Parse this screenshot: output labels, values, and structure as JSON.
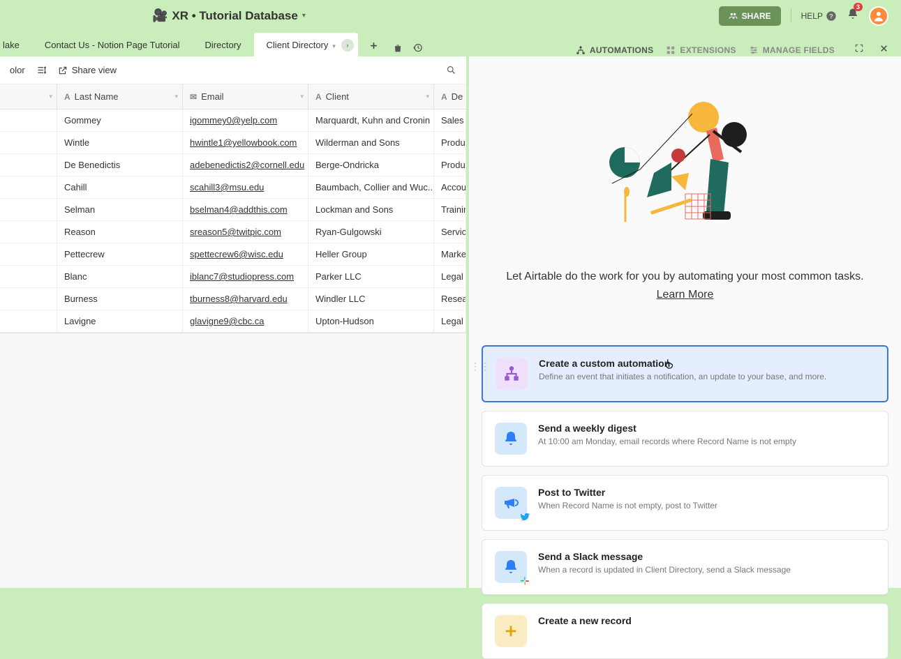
{
  "header": {
    "base_icon": "🎥",
    "title": "XR • Tutorial Database",
    "share_label": "SHARE",
    "help_label": "HELP",
    "notification_count": "3"
  },
  "tabs": {
    "items": [
      {
        "label": "lake",
        "partial": true
      },
      {
        "label": "Contact Us - Notion Page Tutorial"
      },
      {
        "label": "Directory"
      },
      {
        "label": "Client Directory",
        "active": true
      }
    ],
    "tools": {
      "automations": "AUTOMATIONS",
      "extensions": "EXTENSIONS",
      "manage_fields": "MANAGE FIELDS"
    }
  },
  "toolbar": {
    "color": "olor",
    "share_view": "Share view"
  },
  "grid": {
    "columns": [
      "",
      "Last Name",
      "Email",
      "Client",
      "De"
    ],
    "rows": [
      {
        "last": "Gommey",
        "email": "igommey0@yelp.com",
        "client": "Marquardt, Kuhn and Cronin",
        "dept": "Sales"
      },
      {
        "last": "Wintle",
        "email": "hwintle1@yellowbook.com",
        "client": "Wilderman and Sons",
        "dept": "Produ"
      },
      {
        "last": "De Benedictis",
        "email": "adebenedictis2@cornell.edu",
        "client": "Berge-Ondricka",
        "dept": "Produ"
      },
      {
        "last": "Cahill",
        "email": "scahill3@msu.edu",
        "client": "Baumbach, Collier and Wuc...",
        "dept": "Accou"
      },
      {
        "last": "Selman",
        "email": "bselman4@addthis.com",
        "client": "Lockman and Sons",
        "dept": "Trainin"
      },
      {
        "last": "Reason",
        "email": "sreason5@twitpic.com",
        "client": "Ryan-Gulgowski",
        "dept": "Servic"
      },
      {
        "last": "Pettecrew",
        "email": "spettecrew6@wisc.edu",
        "client": "Heller Group",
        "dept": "Marke"
      },
      {
        "last": "Blanc",
        "email": "iblanc7@studiopress.com",
        "client": "Parker LLC",
        "dept": "Legal"
      },
      {
        "last": "Burness",
        "email": "tburness8@harvard.edu",
        "client": "Windler LLC",
        "dept": "Resea"
      },
      {
        "last": "Lavigne",
        "email": "glavigne9@cbc.ca",
        "client": "Upton-Hudson",
        "dept": "Legal"
      }
    ]
  },
  "automations_panel": {
    "description": "Let Airtable do the work for you by automating your most common tasks.",
    "learn_more": "Learn More",
    "cards": [
      {
        "title": "Create a custom automation",
        "sub": "Define an event that initiates a notification, an update to your base, and more.",
        "icon_bg": "#efe1fb",
        "icon_color": "#9b59d0",
        "type": "custom",
        "selected": true
      },
      {
        "title": "Send a weekly digest",
        "sub": "At 10:00 am Monday, email records where Record Name is not empty",
        "icon_bg": "#d3e8fb",
        "icon_color": "#2d7ff9",
        "type": "bell"
      },
      {
        "title": "Post to Twitter",
        "sub": "When Record Name is not empty, post to Twitter",
        "icon_bg": "#d3e8fb",
        "icon_color": "#2d7ff9",
        "type": "megaphone",
        "corner": "twitter"
      },
      {
        "title": "Send a Slack message",
        "sub": "When a record is updated in Client Directory, send a Slack message",
        "icon_bg": "#d3e8fb",
        "icon_color": "#2d7ff9",
        "type": "bell",
        "corner": "slack"
      },
      {
        "title": "Create a new record",
        "sub": "",
        "icon_bg": "#fbecc4",
        "icon_color": "#e0a400",
        "type": "plus"
      }
    ]
  }
}
